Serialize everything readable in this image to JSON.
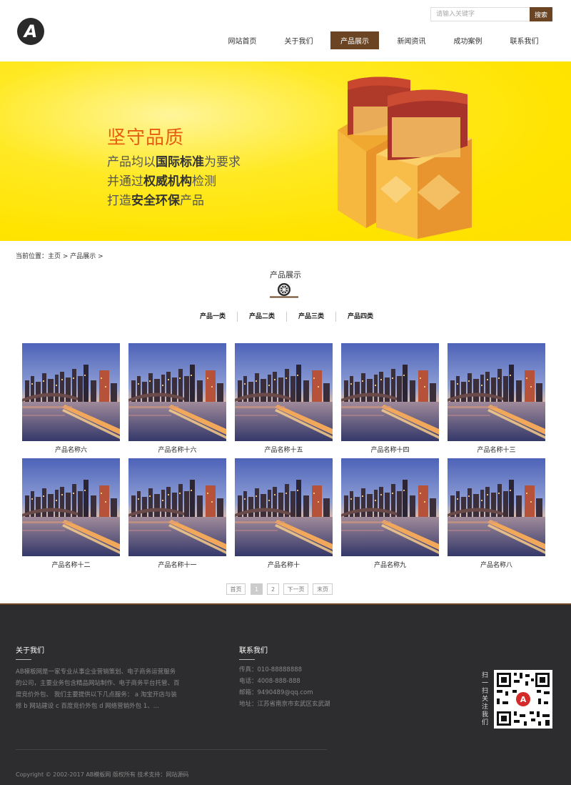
{
  "header": {
    "logo_letter": "A",
    "search_placeholder": "请输入关键字",
    "search_button": "搜索",
    "nav": [
      {
        "label": "网站首页"
      },
      {
        "label": "关于我们"
      },
      {
        "label": "产品展示",
        "active": true
      },
      {
        "label": "新闻资讯"
      },
      {
        "label": "成功案例"
      },
      {
        "label": "联系我们"
      }
    ],
    "accent_color": "#6b4423"
  },
  "banner": {
    "title": "坚守品质",
    "line1": {
      "pre": "产品均以",
      "bold": "国际标准",
      "post": "为要求"
    },
    "line2": {
      "pre": "并通过",
      "bold": "权威机构",
      "post": "检测"
    },
    "line3": {
      "pre": "打造",
      "bold": "安全环保",
      "post": "产品"
    },
    "background_color": "#ffe400",
    "title_color": "#e85d11"
  },
  "breadcrumb": "当前位置：主页 > 产品展示 >",
  "section": {
    "title": "产品展示",
    "icon": "wheel-icon",
    "categories": [
      "产品一类",
      "产品二类",
      "产品三类",
      "产品四类"
    ]
  },
  "products": [
    {
      "name": "产品名称六"
    },
    {
      "name": "产品名称十六"
    },
    {
      "name": "产品名称十五"
    },
    {
      "name": "产品名称十四"
    },
    {
      "name": "产品名称十三"
    },
    {
      "name": "产品名称十二"
    },
    {
      "name": "产品名称十一"
    },
    {
      "name": "产品名称十"
    },
    {
      "name": "产品名称九"
    },
    {
      "name": "产品名称八"
    }
  ],
  "pagination": {
    "first": "首页",
    "pages": [
      "1",
      "2"
    ],
    "current": "1",
    "next": "下一页",
    "last": "末页"
  },
  "footer": {
    "about_title": "关于我们",
    "about_text": "AB模板网是一家专业从事企业营销策划、电子商务运营服务的公司，主要业务包含精品网站制作、电子商务平台托管、百度竞价外包、 我们主要提供以下几点服务： a 淘宝开店与装修 b 网站建设 c 百度竞价外包 d 网络营销外包 1、...",
    "contact_title": "联系我们",
    "fax": "传真：010-88888888",
    "phone": "电话：4008-888-888",
    "email": "邮箱：9490489@qq.com",
    "address": "地址：江苏省南京市玄武区玄武湖",
    "scan_label": "扫一扫关注我们",
    "copyright": "Copyright © 2002-2017 AB模板网 版权所有    技术支持：网站源码",
    "background_color": "#2d2d2f"
  }
}
